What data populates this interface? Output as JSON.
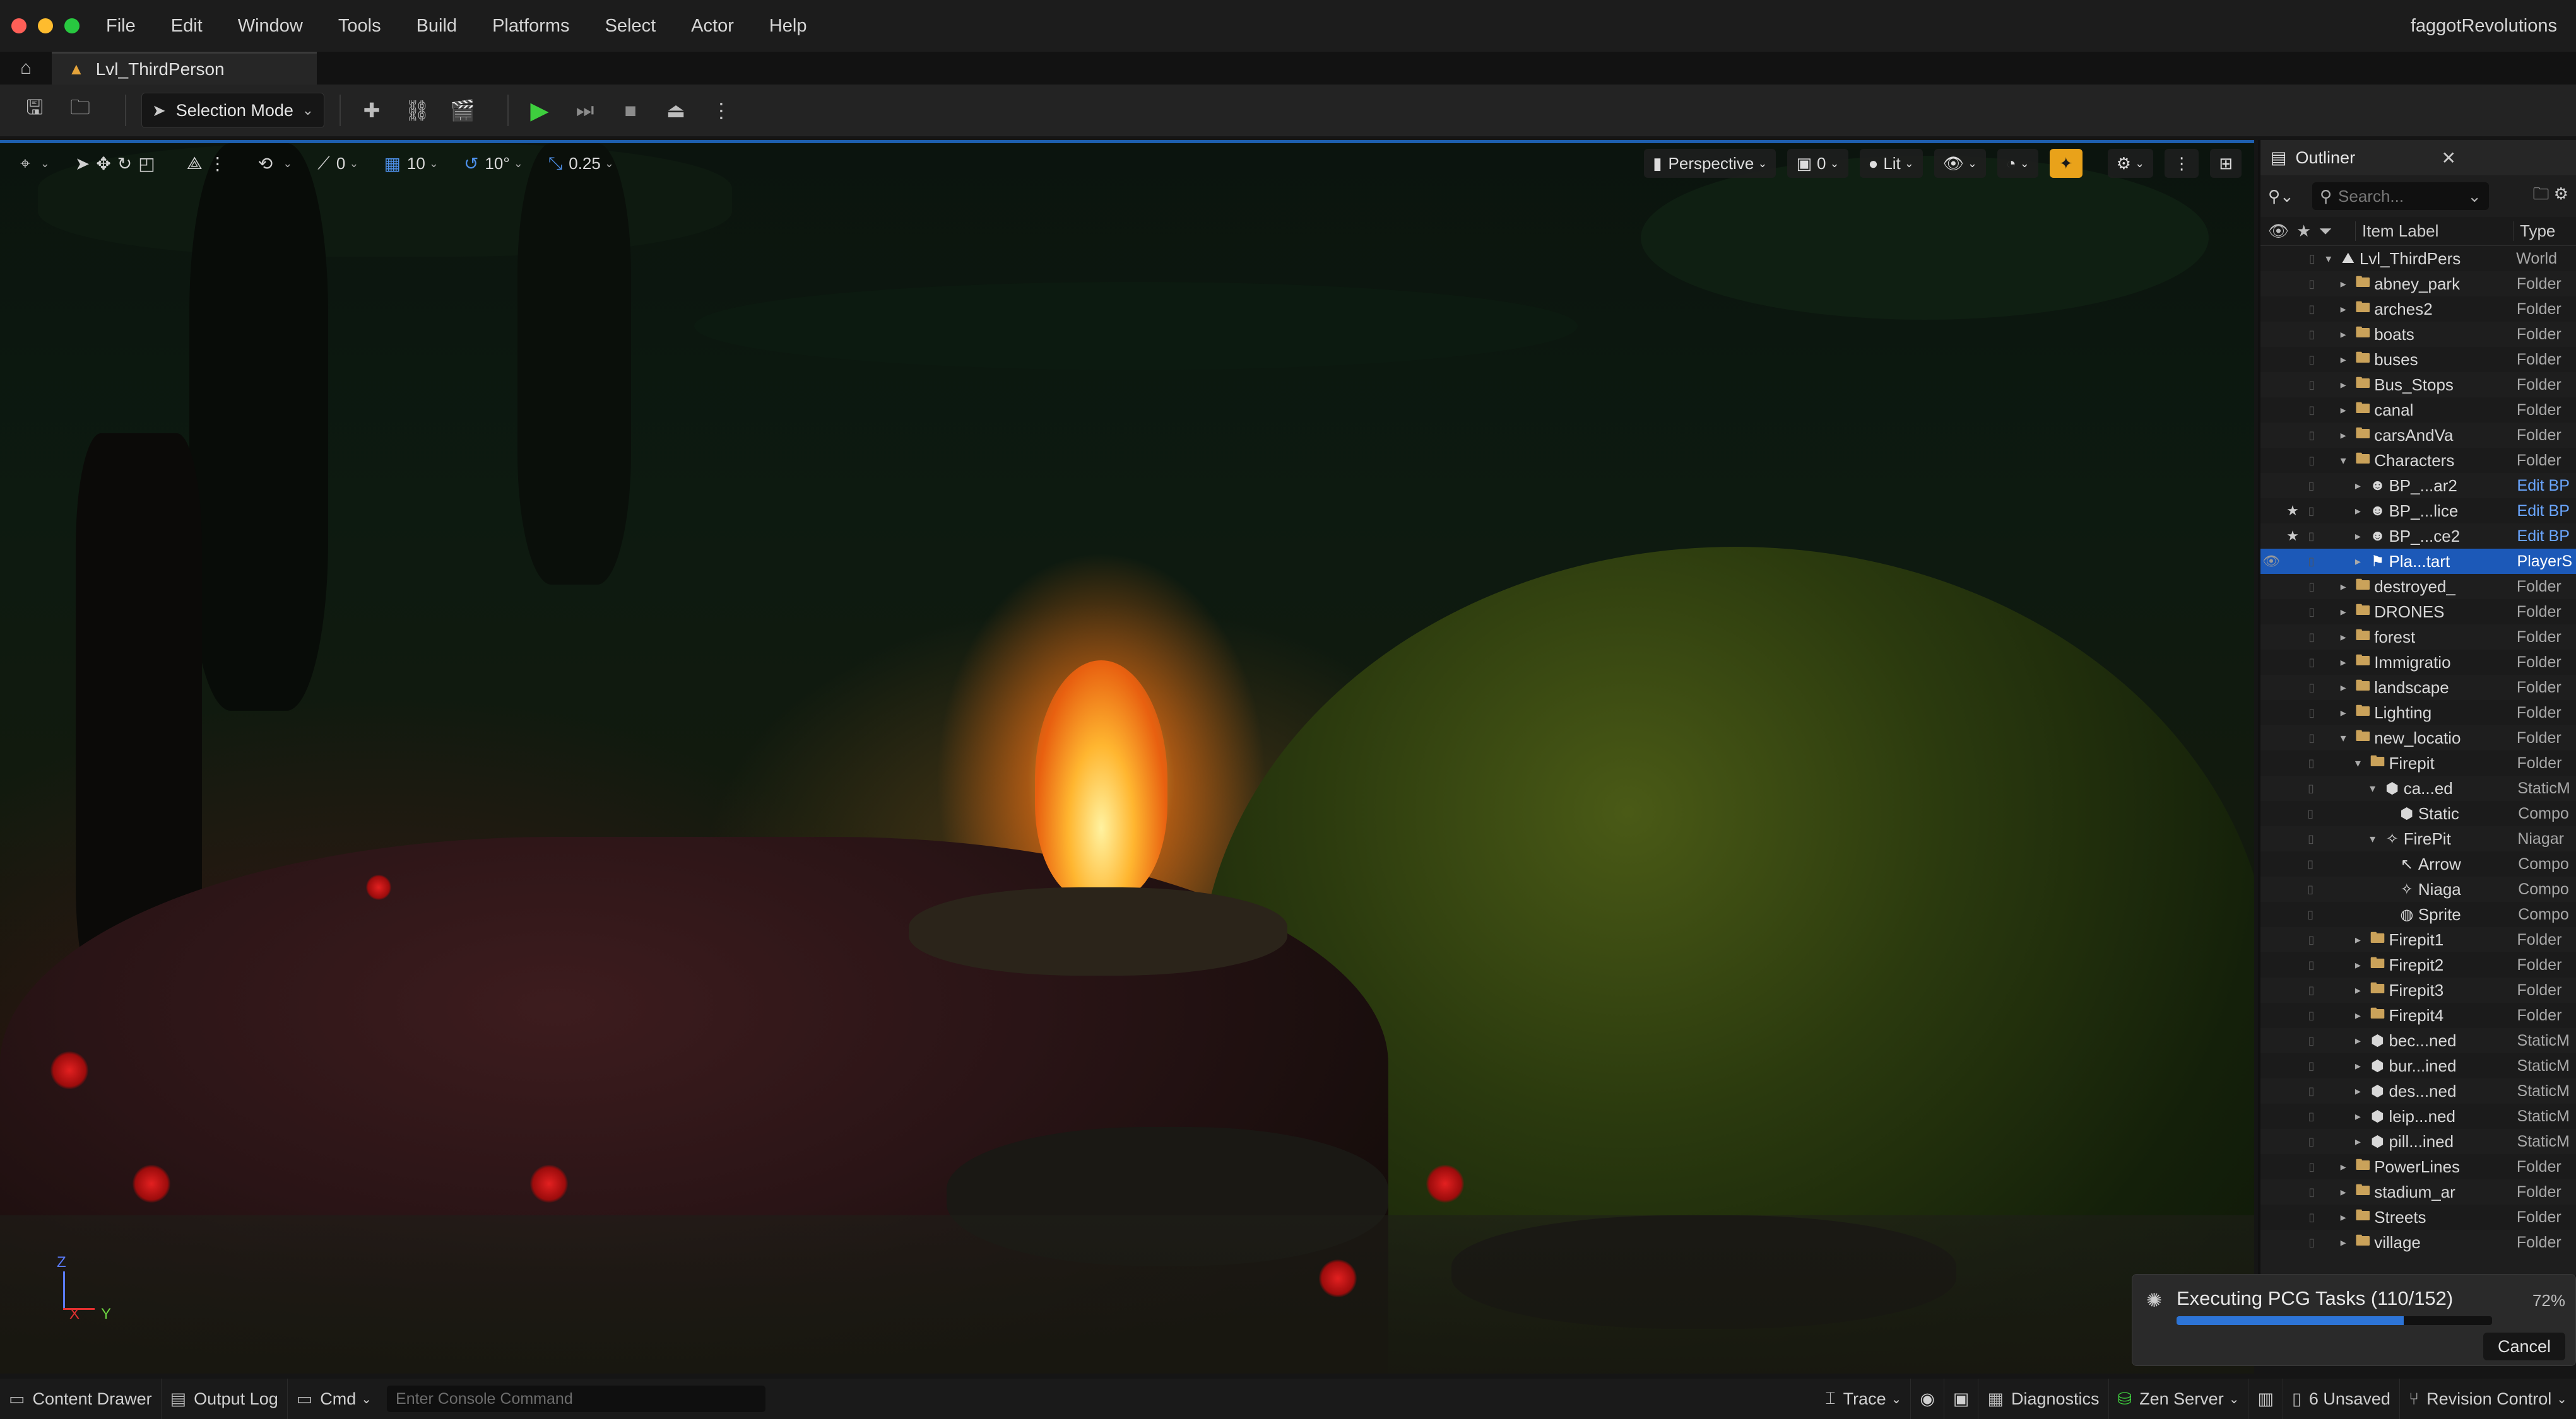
{
  "menubar": {
    "items": [
      "File",
      "Edit",
      "Window",
      "Tools",
      "Build",
      "Platforms",
      "Select",
      "Actor",
      "Help"
    ],
    "project_name": "faggotRevolutions"
  },
  "tabs": {
    "level_tab": "Lvl_ThirdPerson"
  },
  "toolbar": {
    "mode_label": "Selection Mode"
  },
  "viewport": {
    "snap_translate": "0",
    "grid_size": "10",
    "rotation_snap": "10°",
    "scale_snap": "0.25",
    "perspective_label": "Perspective",
    "camera_speed": "0",
    "view_mode": "Lit",
    "axis": {
      "z": "Z",
      "x": "X",
      "y": "Y"
    }
  },
  "outliner": {
    "tab_title": "Outliner",
    "search_placeholder": "Search...",
    "col_label": "Item Label",
    "col_type": "Type",
    "rows": [
      {
        "name": "Lvl_ThirdPers",
        "type": "World",
        "indent": 0,
        "expanded": true,
        "icon": "world"
      },
      {
        "name": "abney_park",
        "type": "Folder",
        "indent": 1,
        "icon": "folder"
      },
      {
        "name": "arches2",
        "type": "Folder",
        "indent": 1,
        "icon": "folder"
      },
      {
        "name": "boats",
        "type": "Folder",
        "indent": 1,
        "icon": "folder"
      },
      {
        "name": "buses",
        "type": "Folder",
        "indent": 1,
        "icon": "folder"
      },
      {
        "name": "Bus_Stops",
        "type": "Folder",
        "indent": 1,
        "icon": "folder"
      },
      {
        "name": "canal",
        "type": "Folder",
        "indent": 1,
        "icon": "folder"
      },
      {
        "name": "carsAndVa",
        "type": "Folder",
        "indent": 1,
        "icon": "folder"
      },
      {
        "name": "Characters",
        "type": "Folder",
        "indent": 1,
        "icon": "folder",
        "expanded": true
      },
      {
        "name": "BP_...ar2",
        "type": "Edit BP",
        "indent": 2,
        "icon": "character",
        "link": true
      },
      {
        "name": "BP_...lice",
        "type": "Edit BP",
        "indent": 2,
        "icon": "character",
        "link": true,
        "star": true
      },
      {
        "name": "BP_...ce2",
        "type": "Edit BP",
        "indent": 2,
        "icon": "character",
        "link": true,
        "star": true
      },
      {
        "name": "Pla...tart",
        "type": "PlayerS",
        "indent": 2,
        "icon": "flag",
        "selected": true
      },
      {
        "name": "destroyed_",
        "type": "Folder",
        "indent": 1,
        "icon": "folder"
      },
      {
        "name": "DRONES",
        "type": "Folder",
        "indent": 1,
        "icon": "folder"
      },
      {
        "name": "forest",
        "type": "Folder",
        "indent": 1,
        "icon": "folder"
      },
      {
        "name": "Immigratio",
        "type": "Folder",
        "indent": 1,
        "icon": "folder"
      },
      {
        "name": "landscape",
        "type": "Folder",
        "indent": 1,
        "icon": "folder"
      },
      {
        "name": "Lighting",
        "type": "Folder",
        "indent": 1,
        "icon": "folder"
      },
      {
        "name": "new_locatio",
        "type": "Folder",
        "indent": 1,
        "icon": "folder",
        "expanded": true
      },
      {
        "name": "Firepit",
        "type": "Folder",
        "indent": 2,
        "icon": "folder",
        "expanded": true
      },
      {
        "name": "ca...ed",
        "type": "StaticM",
        "indent": 3,
        "icon": "mesh",
        "expanded": true
      },
      {
        "name": "Static",
        "type": "Compo",
        "indent": 4,
        "icon": "mesh"
      },
      {
        "name": "FirePit",
        "type": "Niagar",
        "indent": 3,
        "icon": "niagara",
        "expanded": true
      },
      {
        "name": "Arrow",
        "type": "Compo",
        "indent": 4,
        "icon": "arrow"
      },
      {
        "name": "Niaga",
        "type": "Compo",
        "indent": 4,
        "icon": "niagara"
      },
      {
        "name": "Sprite",
        "type": "Compo",
        "indent": 4,
        "icon": "sprite"
      },
      {
        "name": "Firepit1",
        "type": "Folder",
        "indent": 2,
        "icon": "folder"
      },
      {
        "name": "Firepit2",
        "type": "Folder",
        "indent": 2,
        "icon": "folder"
      },
      {
        "name": "Firepit3",
        "type": "Folder",
        "indent": 2,
        "icon": "folder"
      },
      {
        "name": "Firepit4",
        "type": "Folder",
        "indent": 2,
        "icon": "folder"
      },
      {
        "name": "bec...ned",
        "type": "StaticM",
        "indent": 2,
        "icon": "mesh"
      },
      {
        "name": "bur...ined",
        "type": "StaticM",
        "indent": 2,
        "icon": "mesh"
      },
      {
        "name": "des...ned",
        "type": "StaticM",
        "indent": 2,
        "icon": "mesh"
      },
      {
        "name": "leip...ned",
        "type": "StaticM",
        "indent": 2,
        "icon": "mesh"
      },
      {
        "name": "pill...ined",
        "type": "StaticM",
        "indent": 2,
        "icon": "mesh"
      },
      {
        "name": "PowerLines",
        "type": "Folder",
        "indent": 1,
        "icon": "folder"
      },
      {
        "name": "stadium_ar",
        "type": "Folder",
        "indent": 1,
        "icon": "folder"
      },
      {
        "name": "Streets",
        "type": "Folder",
        "indent": 1,
        "icon": "folder"
      },
      {
        "name": "village",
        "type": "Folder",
        "indent": 1,
        "icon": "folder"
      }
    ]
  },
  "notification": {
    "title": "Executing PCG Tasks (110/152)",
    "percent_label": "72%",
    "progress": 0.72,
    "cancel_label": "Cancel"
  },
  "statusbar": {
    "content_drawer": "Content Drawer",
    "output_log": "Output Log",
    "cmd": "Cmd",
    "console_placeholder": "Enter Console Command",
    "trace": "Trace",
    "diagnostics": "Diagnostics",
    "zen_server": "Zen Server",
    "unsaved": "6 Unsaved",
    "revision_control": "Revision Control"
  },
  "colors": {
    "accent_blue": "#1c59b8",
    "play_green": "#3ecf3e",
    "highlight_orange": "#e9a21a",
    "folder": "#caa25a"
  }
}
